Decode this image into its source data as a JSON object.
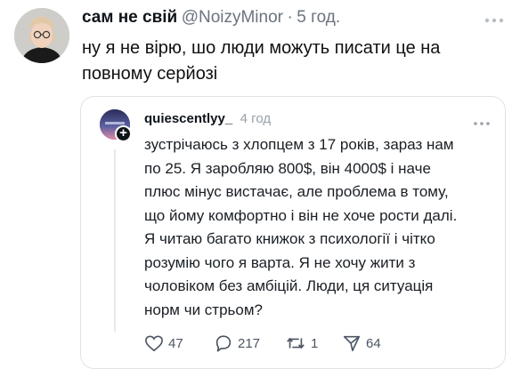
{
  "tweet": {
    "author_name": "сам не свій",
    "author_handle": "@NoizyMinor",
    "separator": "·",
    "time": "5 год.",
    "text_line_1": "ну я не вірю, шо люди можуть писати це на",
    "text_line_2": "повному серйозі"
  },
  "quote": {
    "username": "quiescentlyy_",
    "time": "4 год",
    "follow_badge": "+",
    "lines": [
      "зустрічаюсь з хлопцем з 17 років, зараз нам",
      "по 25. Я заробляю 800$, він 4000$ і наче",
      "плюс мінус вистачає, але проблема в тому,",
      "що йому комфортно і він не хоче рости далі.",
      "Я читаю багато книжок з психології і чітко",
      "розумію чого я варта. Я не хочу жити з",
      "чоловіком без амбіцій. Люди, ця ситуація",
      "норм чи стрьом?"
    ],
    "actions": {
      "likes": "47",
      "replies": "217",
      "reposts": "1",
      "shares": "64"
    }
  },
  "icons": {
    "like": "heart-icon",
    "reply": "reply-bubble-icon",
    "repost": "repost-icon",
    "share": "share-plane-icon",
    "more": "more-dots-icon"
  },
  "colors": {
    "text": "#0f1419",
    "muted": "#6b7280",
    "border": "#dfe3e6"
  }
}
